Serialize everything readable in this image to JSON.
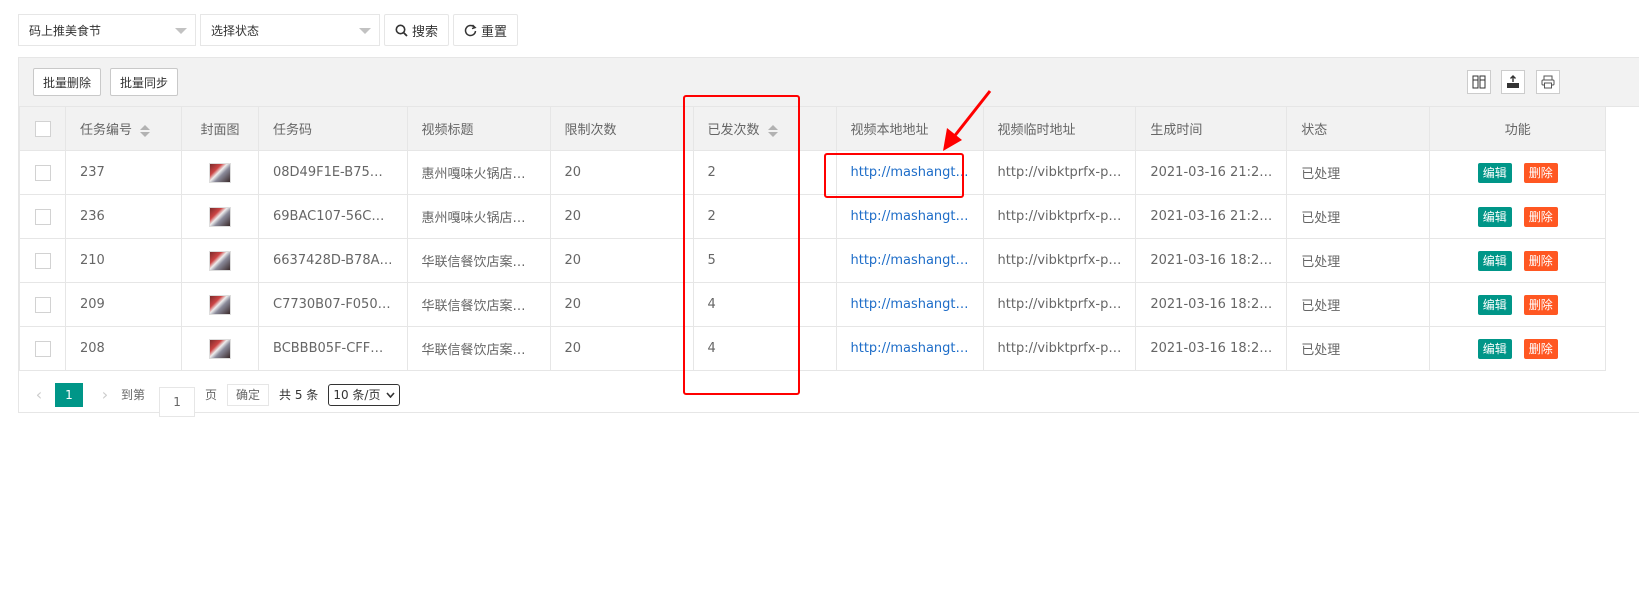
{
  "search": {
    "category_value": "码上推美食节",
    "status_placeholder": "选择状态",
    "search_label": "搜索",
    "reset_label": "重置"
  },
  "toolbar": {
    "batch_delete": "批量删除",
    "batch_sync": "批量同步",
    "icons": [
      "columns-icon",
      "export-icon",
      "print-icon"
    ]
  },
  "table": {
    "headers": [
      "任务编号",
      "封面图",
      "任务码",
      "视频标题",
      "限制次数",
      "已发次数",
      "视频本地地址",
      "视频临时地址",
      "生成时间",
      "状态",
      "功能"
    ],
    "rows": [
      {
        "id": "237",
        "code": "08D49F1E-B75…",
        "title": "惠州嘎味火锅店…",
        "limit": "20",
        "sent": "2",
        "local": "http://mashangt…",
        "temp": "http://vibktprfx-p…",
        "time": "2021-03-16 21:2…",
        "status": "已处理"
      },
      {
        "id": "236",
        "code": "69BAC107-56C…",
        "title": "惠州嘎味火锅店…",
        "limit": "20",
        "sent": "2",
        "local": "http://mashangt…",
        "temp": "http://vibktprfx-p…",
        "time": "2021-03-16 21:2…",
        "status": "已处理"
      },
      {
        "id": "210",
        "code": "6637428D-B78A…",
        "title": "华联信餐饮店案…",
        "limit": "20",
        "sent": "5",
        "local": "http://mashangt…",
        "temp": "http://vibktprfx-p…",
        "time": "2021-03-16 18:2…",
        "status": "已处理"
      },
      {
        "id": "209",
        "code": "C7730B07-F050…",
        "title": "华联信餐饮店案…",
        "limit": "20",
        "sent": "4",
        "local": "http://mashangt…",
        "temp": "http://vibktprfx-p…",
        "time": "2021-03-16 18:2…",
        "status": "已处理"
      },
      {
        "id": "208",
        "code": "BCBBB05F-CFF…",
        "title": "华联信餐饮店案…",
        "limit": "20",
        "sent": "4",
        "local": "http://mashangt…",
        "temp": "http://vibktprfx-p…",
        "time": "2021-03-16 18:2…",
        "status": "已处理"
      }
    ],
    "edit_label": "编辑",
    "delete_label": "删除"
  },
  "pager": {
    "current_page": "1",
    "goto_label": "到第",
    "goto_value": "1",
    "page_label": "页",
    "confirm_label": "确定",
    "total_label": "共 5 条",
    "page_size": "10 条/页"
  },
  "colors": {
    "edit": "#009688",
    "delete": "#FF5722",
    "link": "#1E6DC8",
    "annotation": "#FF0000"
  }
}
